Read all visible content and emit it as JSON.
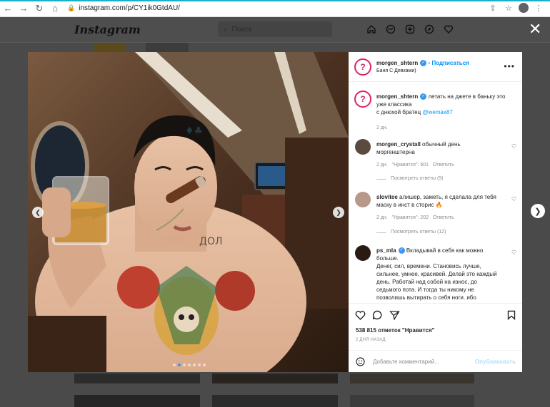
{
  "browser": {
    "url": "instagram.com/p/CY1ik0GtdAU/"
  },
  "instagram": {
    "logo": "Instagram",
    "search_placeholder": "Поиск"
  },
  "post": {
    "author": "morgen_shtern",
    "follow_label": "Подписаться",
    "location": "Баня С Девками)",
    "caption_line1": "летать на джете в баньку это",
    "caption_line2": "уже классика",
    "caption_line3": "с днюхой братец",
    "caption_mention": "@wemax87",
    "caption_time": "2 дн.",
    "likes": "538 815 отметок \"Нравится\"",
    "posted": "2 ДНЯ НАЗАД",
    "comment_placeholder": "Добавьте комментарий...",
    "publish_label": "Опубликовать",
    "photo_dots": 7,
    "photo_active_dot": 1
  },
  "comments": [
    {
      "user": "morgen_crystall",
      "text1": "обычный день",
      "text2": "моргенштерна",
      "time": "2 дн.",
      "likes": "\"Нравится\": 601",
      "reply": "Ответить",
      "view_replies": "Посмотреть ответы (9)"
    },
    {
      "user": "slovitee",
      "text1": "алишер, заметь, я сделала для тебя",
      "text2": "маску в инст в сторис 🔥",
      "time": "2 дн.",
      "likes": "\"Нравится\": 202",
      "reply": "Ответить",
      "view_replies": "Посмотреть ответы (12)"
    },
    {
      "user": "ps_mla",
      "line1": "Вкладывай в себя как можно",
      "line2": "больше.",
      "line3": "Денег, сил, времени. Становись лучше,",
      "line4": "сильнее, умнее, красивей. Делай это каждый",
      "line5": "день. Работай над собой на износ, до",
      "line6": "седьмого пота. И тогда ты никому не",
      "line7": "позволишь вытирать о себя ноги. ибо"
    }
  ]
}
